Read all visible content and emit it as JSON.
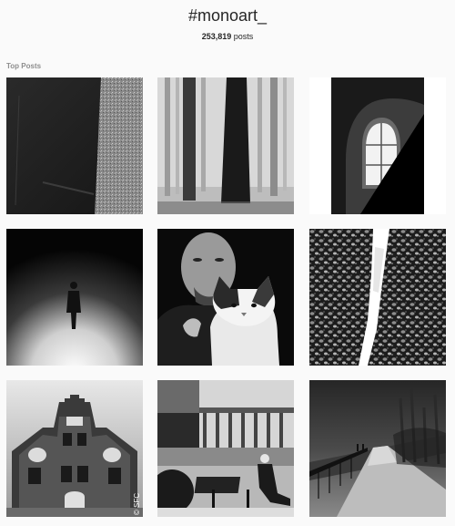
{
  "header": {
    "hashtag": "#monoart_",
    "post_count": "253,819",
    "post_count_suffix": "posts"
  },
  "section": {
    "title": "Top Posts"
  },
  "posts": [
    {
      "subject": "concrete wall texture"
    },
    {
      "subject": "misty forest trees"
    },
    {
      "subject": "arched window in wall"
    },
    {
      "subject": "figure walking in fog"
    },
    {
      "subject": "man holding a cat"
    },
    {
      "subject": "rock surface with light streak"
    },
    {
      "subject": "gabled building facade"
    },
    {
      "subject": "person sitting on bench by veranda"
    },
    {
      "subject": "people walking on snowy path"
    }
  ],
  "watermark": "© SFC"
}
